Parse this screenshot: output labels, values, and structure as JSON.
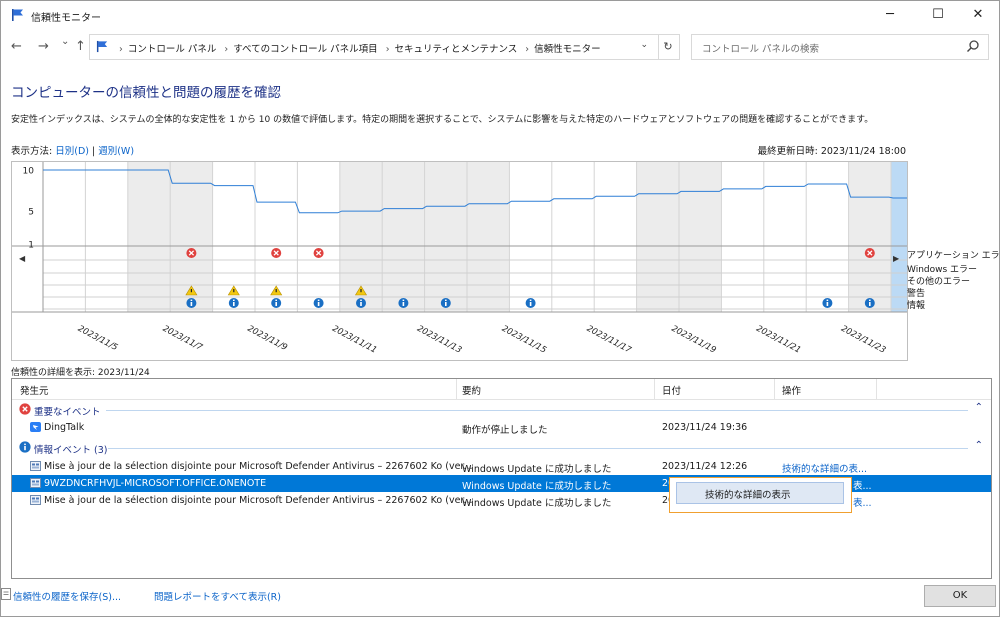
{
  "window": {
    "title": "信頼性モニター",
    "minimize": "─",
    "maximize": "☐",
    "close": "✕"
  },
  "nav": {
    "back": "←",
    "forward": "→",
    "recent": "⌄",
    "up": "↑",
    "breadcrumbs": [
      "コントロール パネル",
      "すべてのコントロール パネル項目",
      "セキュリティとメンテナンス",
      "信頼性モニター"
    ],
    "refresh": "↻",
    "search_placeholder": "コントロール パネルの検索"
  },
  "heading": "コンピューターの信頼性と問題の履歴を確認",
  "description": "安定性インデックスは、システムの全体的な安定性を 1 から 10 の数値で評価します。特定の期間を選択することで、システムに影響を与えた特定のハードウェアとソフトウェアの問題を確認することができます。",
  "view_by": {
    "label": "表示方法: ",
    "daily": "日別(D)",
    "sep": " | ",
    "weekly": "週別(W)"
  },
  "last_updated": "最終更新日時: 2023/11/24 18:00",
  "chart_data": {
    "type": "line",
    "y_ticks": [
      "10",
      "5",
      "1"
    ],
    "ylim": [
      1,
      10
    ],
    "x_dates": [
      "2023/11/5",
      "2023/11/7",
      "2023/11/9",
      "2023/11/11",
      "2023/11/13",
      "2023/11/15",
      "2023/11/17",
      "2023/11/19",
      "2023/11/21",
      "2023/11/23"
    ],
    "days": [
      "11/4",
      "11/5",
      "11/6",
      "11/7",
      "11/8",
      "11/9",
      "11/10",
      "11/11",
      "11/12",
      "11/13",
      "11/14",
      "11/15",
      "11/16",
      "11/17",
      "11/18",
      "11/19",
      "11/20",
      "11/21",
      "11/22",
      "11/23",
      "11/24"
    ],
    "stability_index": [
      10,
      10,
      10,
      8.4,
      8.1,
      6.1,
      4.8,
      5.0,
      5.3,
      5.6,
      5.9,
      6.2,
      6.5,
      6.8,
      7.1,
      7.4,
      7.7,
      8.0,
      8.3,
      6.7,
      6.6
    ],
    "selected_day": "11/24",
    "event_rows": [
      "アプリケーション エラー",
      "Windows エラー",
      "その他のエラー",
      "警告",
      "情報"
    ],
    "app_errors": [
      "11/7",
      "11/9",
      "11/10",
      "11/23",
      "11/24"
    ],
    "warnings": [
      "11/7",
      "11/8",
      "11/9",
      "11/11"
    ],
    "info": [
      "11/7",
      "11/8",
      "11/9",
      "11/10",
      "11/11",
      "11/12",
      "11/13",
      "11/15",
      "11/22",
      "11/23",
      "11/24"
    ]
  },
  "details_label": "信頼性の詳細を表示: 2023/11/24",
  "columns": {
    "source": "発生元",
    "summary": "要約",
    "date": "日付",
    "action": "操作"
  },
  "groups": {
    "critical": "重要なイベント",
    "info": "情報イベント (3)"
  },
  "critical_rows": [
    {
      "source": "DingTalk",
      "summary": "動作が停止しました",
      "date": "2023/11/24 19:36",
      "action": ""
    }
  ],
  "info_rows": [
    {
      "source": "Mise à jour de la sélection disjointe pour Microsoft Defender Antivirus – 2267602 Ko (ver...",
      "summary": "Windows Update に成功しました",
      "date": "2023/11/24 12:26",
      "action": "技術的な詳細の表..."
    },
    {
      "source": "9WZDNCRFHVJL-MICROSOFT.OFFICE.ONENOTE",
      "summary": "Windows Update に成功しました",
      "date": "202",
      "action": "表..."
    },
    {
      "source": "Mise à jour de la sélection disjointe pour Microsoft Defender Antivirus – 2267602 Ko (ver...",
      "summary": "Windows Update に成功しました",
      "date": "20",
      "action": "表..."
    }
  ],
  "context_menu": {
    "item": "技術的な詳細の表示"
  },
  "bottom": {
    "save": "信頼性の履歴を保存(S)...",
    "report": "問題レポートをすべて表示(R)",
    "ok": "OK"
  },
  "colors": {
    "accent": "#0078d7",
    "heading": "#1e3287",
    "link": "#0a63c9",
    "error": "#e0423f",
    "warning": "#f2c811",
    "info": "#1a6fc4"
  }
}
